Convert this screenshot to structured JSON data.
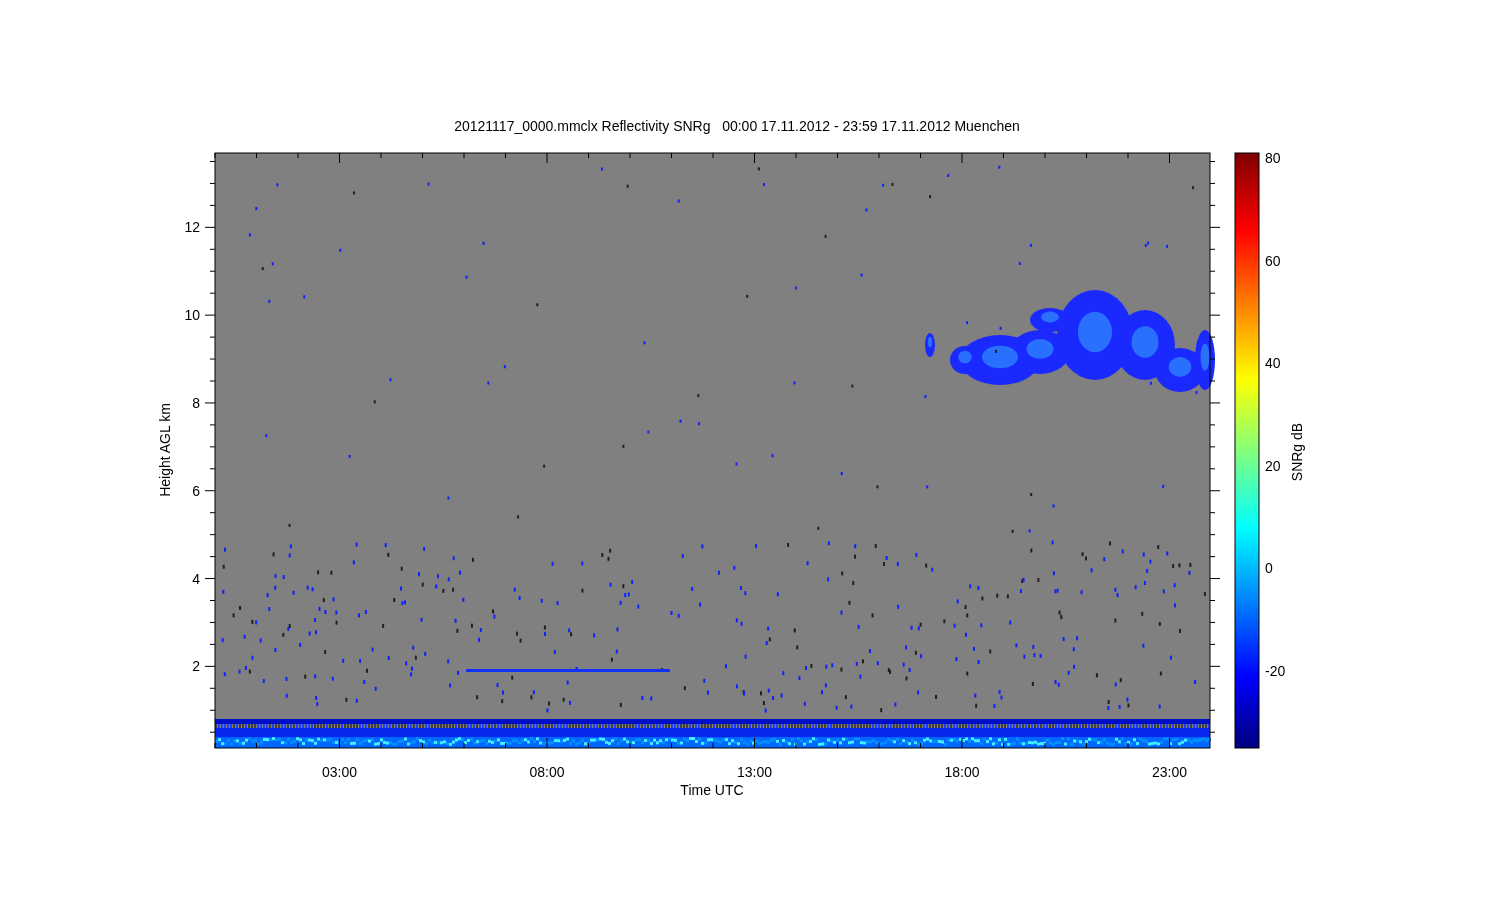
{
  "title": "20121117_0000.mmclx Reflectivity SNRg   00:00 17.11.2012 - 23:59 17.11.2012 Muenchen",
  "plot": {
    "xlabel": "Time UTC",
    "ylabel": "Height AGL km",
    "xticks": [
      "03:00",
      "08:00",
      "13:00",
      "18:00",
      "23:00"
    ],
    "yticks": [
      "12",
      "10",
      "8",
      "6",
      "4",
      "2"
    ]
  },
  "colorbar": {
    "label": "SNRg dB",
    "ticks": [
      "80",
      "60",
      "40",
      "20",
      "0",
      "-20"
    ]
  }
}
